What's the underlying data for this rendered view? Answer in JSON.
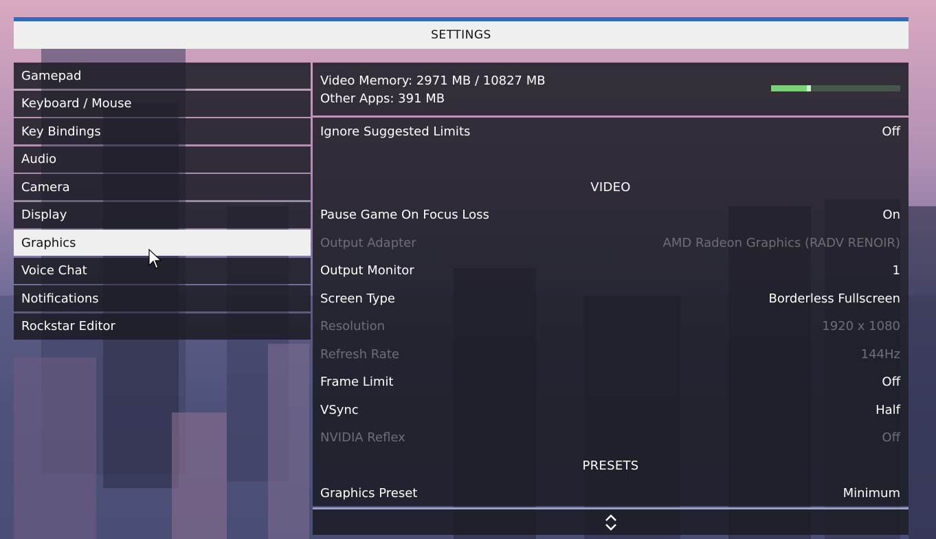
{
  "header": {
    "title": "SETTINGS"
  },
  "menu": {
    "items": [
      {
        "label": "Gamepad"
      },
      {
        "label": "Keyboard / Mouse"
      },
      {
        "label": "Key Bindings"
      },
      {
        "label": "Audio"
      },
      {
        "label": "Camera"
      },
      {
        "label": "Display"
      },
      {
        "label": "Graphics"
      },
      {
        "label": "Voice Chat"
      },
      {
        "label": "Notifications"
      },
      {
        "label": "Rockstar Editor"
      }
    ],
    "active": "Graphics"
  },
  "memory": {
    "video_memory": "Video Memory: 2971 MB / 10827 MB",
    "other_apps": "Other Apps: 391 MB",
    "used_fraction": 0.274,
    "other_fraction": 0.036
  },
  "settings": {
    "ignore_limits": {
      "label": "Ignore Suggested Limits",
      "value": "Off"
    },
    "video_section": "VIDEO",
    "pause_focus": {
      "label": "Pause Game On Focus Loss",
      "value": "On"
    },
    "output_adapter": {
      "label": "Output Adapter",
      "value": "AMD Radeon Graphics (RADV RENOIR)"
    },
    "output_monitor": {
      "label": "Output Monitor",
      "value": "1"
    },
    "screen_type": {
      "label": "Screen Type",
      "value": "Borderless Fullscreen"
    },
    "resolution": {
      "label": "Resolution",
      "value": "1920 x 1080"
    },
    "refresh_rate": {
      "label": "Refresh Rate",
      "value": "144Hz"
    },
    "frame_limit": {
      "label": "Frame Limit",
      "value": "Off"
    },
    "vsync": {
      "label": "VSync",
      "value": "Half"
    },
    "nvidia_reflex": {
      "label": "NVIDIA Reflex",
      "value": "Off"
    },
    "presets_section": "PRESETS",
    "graphics_preset": {
      "label": "Graphics Preset",
      "value": "Minimum"
    }
  },
  "colors": {
    "accent": "#2f6bbf",
    "memory_used": "#7dd07a",
    "memory_other": "#c9f0c6",
    "panel_bg": "#1c1c24"
  }
}
